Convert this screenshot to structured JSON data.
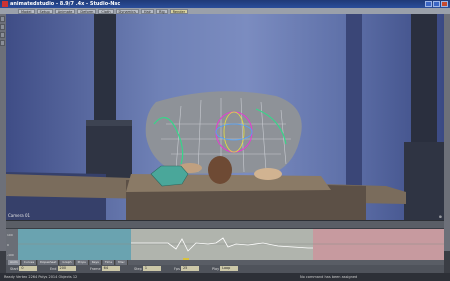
{
  "window": {
    "title": "animatedstudio - 8.9/7 .4x - Studio-Nsc"
  },
  "menu": {
    "items": [
      "Model",
      "Setup",
      "Animate",
      "Deform",
      "Cloth",
      "Dynamics",
      "Hair",
      "Rig",
      "Render"
    ]
  },
  "viewport": {
    "label": "Camera 01",
    "corner": "⊕"
  },
  "curve": {
    "axis_labels": [
      "100",
      "0",
      "-100"
    ]
  },
  "controls": {
    "tabs": [
      "Anim",
      "Curves",
      "Dopesheet",
      "Graph",
      "Props",
      "Keys",
      "Time",
      "Misc"
    ],
    "fields": [
      {
        "label": "Start",
        "value": "0"
      },
      {
        "label": "End",
        "value": "200"
      },
      {
        "label": "Frame",
        "value": "64"
      },
      {
        "label": "Step",
        "value": "1"
      },
      {
        "label": "Fps",
        "value": "25"
      },
      {
        "label": "Play",
        "value": "Loop"
      }
    ]
  },
  "status": {
    "left": "Ready    Vertex 2264   Polys 2014   Objects 12",
    "right": "No command has been assigned"
  },
  "colors": {
    "curve_left_bg": "#6aa3b0",
    "curve_mid_bg": "#b0b4ad",
    "curve_right_bg": "#c79a9f",
    "accent": "#d8c23c"
  }
}
